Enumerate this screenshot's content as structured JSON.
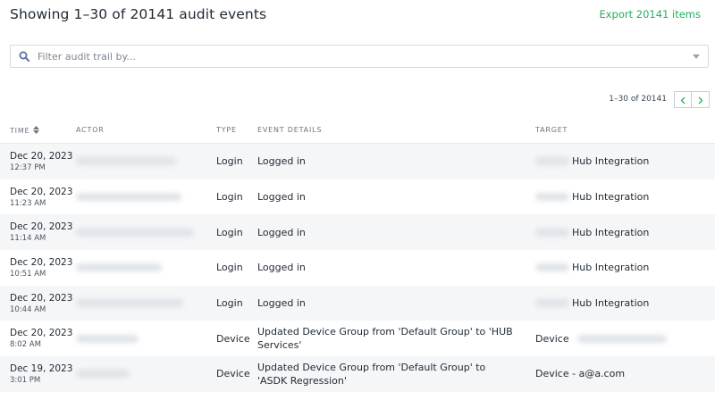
{
  "header": {
    "title": "Showing 1–30 of 20141 audit events",
    "export_label": "Export 20141 items"
  },
  "filter": {
    "placeholder": "Filter audit trail by...",
    "value": ""
  },
  "pager": {
    "range_label": "1–30 of 20141"
  },
  "columns": {
    "time": "Time",
    "actor": "Actor",
    "type": "Type",
    "event_details": "Event Details",
    "target": "Target"
  },
  "rows": [
    {
      "date": "Dec 20, 2023",
      "time": "12:37 PM",
      "type": "Login",
      "details": "Logged in",
      "target_prefix": "",
      "target": "Hub Integration"
    },
    {
      "date": "Dec 20, 2023",
      "time": "11:23 AM",
      "type": "Login",
      "details": "Logged in",
      "target_prefix": "",
      "target": "Hub Integration"
    },
    {
      "date": "Dec 20, 2023",
      "time": "11:14 AM",
      "type": "Login",
      "details": "Logged in",
      "target_prefix": "",
      "target": "Hub Integration"
    },
    {
      "date": "Dec 20, 2023",
      "time": "10:51 AM",
      "type": "Login",
      "details": "Logged in",
      "target_prefix": "",
      "target": "Hub Integration"
    },
    {
      "date": "Dec 20, 2023",
      "time": "10:44 AM",
      "type": "Login",
      "details": "Logged in",
      "target_prefix": "",
      "target": "Hub Integration"
    },
    {
      "date": "Dec 20, 2023",
      "time": "8:02 AM",
      "type": "Device",
      "details": "Updated Device Group from 'Default Group' to 'HUB Services'",
      "target_prefix": "Device",
      "target": ""
    },
    {
      "date": "Dec 19, 2023",
      "time": "3:01 PM",
      "type": "Device",
      "details": "Updated Device Group from 'Default Group' to 'ASDK Regression'",
      "target_prefix": "Device - a@a.com",
      "target": ""
    }
  ],
  "colors": {
    "accent": "#1fb25a",
    "row_stripe": "#f4f6f8",
    "border": "#d6dbe0"
  },
  "icons": {
    "filter": "search-icon",
    "dropdown": "chevron-down-icon",
    "sort": "sort-icon",
    "prev": "chevron-left-icon",
    "next": "chevron-right-icon"
  }
}
